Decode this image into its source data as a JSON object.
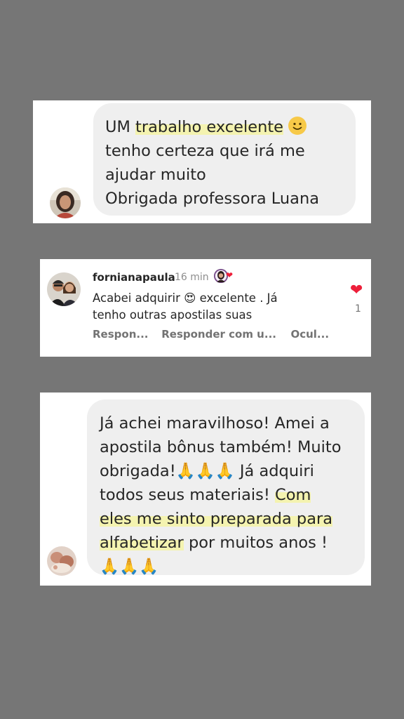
{
  "card1": {
    "lines": [
      [
        "UM ",
        "trabalho excelente",
        " 🙂"
      ],
      "tenho certeza que irá me",
      "ajudar muito",
      "Obrigada professora Luana"
    ],
    "line1_pre": "UM ",
    "line1_hl": "trabalho excelente",
    "line1_emoji": "🙂",
    "line2": "tenho certeza que irá me",
    "line3": "ajudar muito",
    "line4": "Obrigada professora Luana"
  },
  "card2": {
    "username": "fornianapaula",
    "time": "16 min",
    "comment_line1": "Acabei adquirir 😍 excelente . Já",
    "comment_line2": "tenho outras apostilas suas",
    "action_reply": "Respon...",
    "action_reply_with": "Responder com u...",
    "action_hide": "Ocul...",
    "like_count": "1",
    "heart_icon": "❤",
    "accent_color": "#ed1f3a"
  },
  "card3": {
    "line1": "Já achei maravilhoso! Amei a",
    "line2": "apostila bônus também! Muito",
    "line3": "obrigada!🙏🙏🙏 Já adquiri",
    "line4_pre": "todos seus materiais! ",
    "line4_hl": "Com",
    "line5_hl": "eles me sinto preparada para",
    "line6_hl": "alfabetizar",
    "line6_post": " por muitos anos !",
    "line7": "🙏🙏🙏"
  },
  "colors": {
    "background": "#767676",
    "card": "#ffffff",
    "bubble": "#efefef",
    "highlight": "#f4f3b0"
  }
}
